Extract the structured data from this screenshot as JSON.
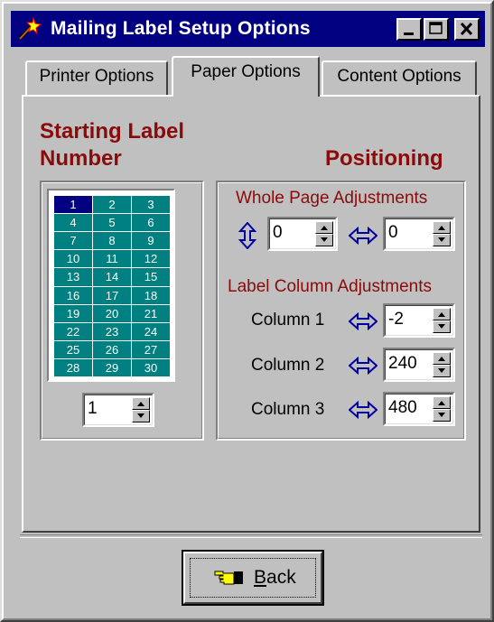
{
  "window": {
    "title": "Mailing Label Setup Options",
    "icon": "magic-wand-icon"
  },
  "title_buttons": {
    "minimize": "minimize-icon",
    "maximize": "maximize-icon",
    "close": "close-icon"
  },
  "tabs": [
    {
      "label": "Printer Options",
      "active": false
    },
    {
      "label": "Paper Options",
      "active": true
    },
    {
      "label": "Content Options",
      "active": false
    }
  ],
  "starting_label": {
    "heading_line1": "Starting Label",
    "heading_line2": "Number",
    "labels": [
      "1",
      "2",
      "3",
      "4",
      "5",
      "6",
      "7",
      "8",
      "9",
      "10",
      "11",
      "12",
      "13",
      "14",
      "15",
      "16",
      "17",
      "18",
      "19",
      "20",
      "21",
      "22",
      "23",
      "24",
      "25",
      "26",
      "27",
      "28",
      "29",
      "30"
    ],
    "selected": "1",
    "spinner_value": "1"
  },
  "positioning": {
    "heading": "Positioning",
    "whole_page_heading": "Whole Page Adjustments",
    "vertical_value": "0",
    "horizontal_value": "0",
    "label_column_heading": "Label Column Adjustments",
    "columns": [
      {
        "label": "Column 1",
        "value": "-2"
      },
      {
        "label": "Column 2",
        "value": "240"
      },
      {
        "label": "Column 3",
        "value": "480"
      }
    ]
  },
  "back_button": {
    "mnemonic": "B",
    "rest": "ack",
    "icon": "pointing-hand-icon"
  },
  "colors": {
    "title_bar": "#000080",
    "heading": "#8b0a0a",
    "label_cell": "#008080",
    "label_selected": "#000080",
    "arrow_blue": "#0000a0"
  }
}
